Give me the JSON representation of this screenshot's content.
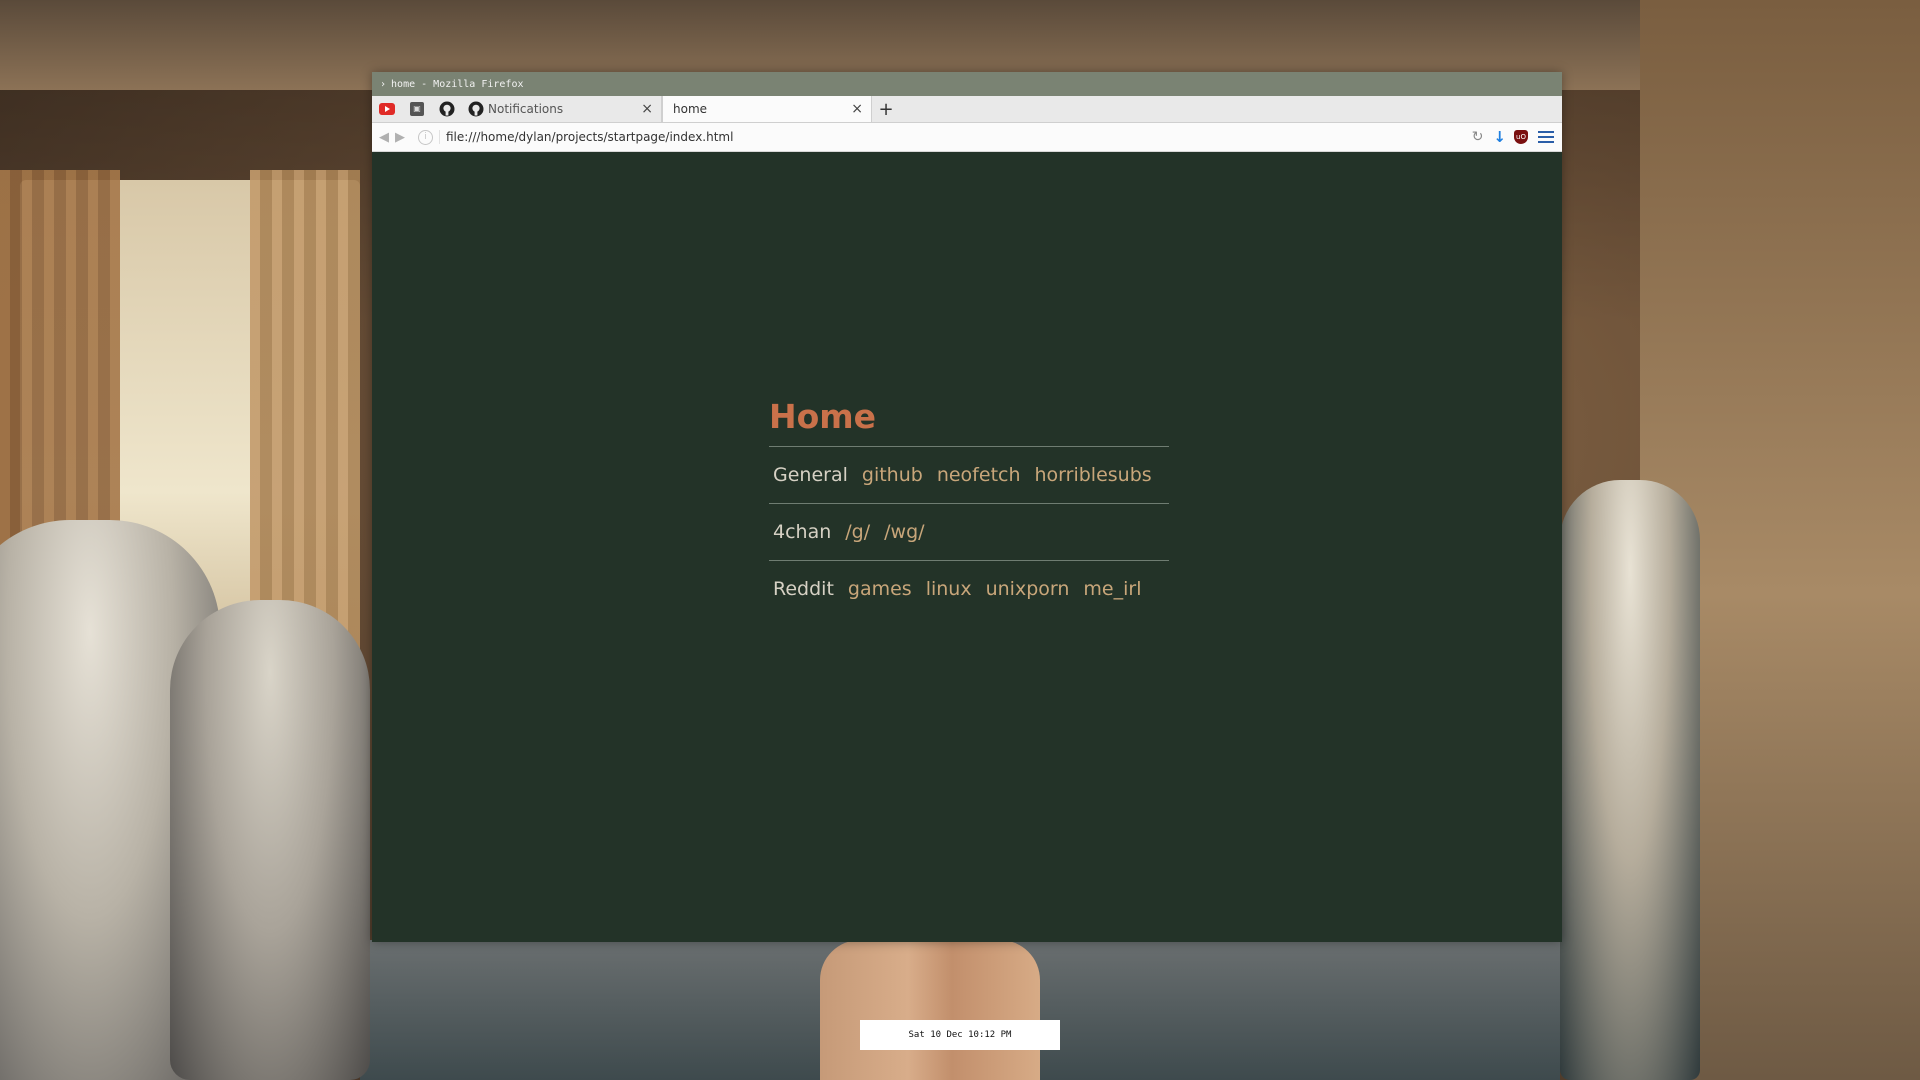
{
  "window": {
    "title": "home - Mozilla Firefox"
  },
  "tabs": {
    "pinned": [
      {
        "icon": "youtube-icon"
      },
      {
        "icon": "app-icon"
      },
      {
        "icon": "github-icon"
      }
    ],
    "items": [
      {
        "label": "Notifications",
        "icon": "github-icon",
        "active": false
      },
      {
        "label": "home",
        "active": true
      }
    ]
  },
  "navbar": {
    "url": "file:///home/dylan/projects/startpage/index.html"
  },
  "startpage": {
    "title": "Home",
    "rows": [
      {
        "category": "General",
        "links": [
          "github",
          "neofetch",
          "horriblesubs"
        ]
      },
      {
        "category": "4chan",
        "links": [
          "/g/",
          "/wg/"
        ]
      },
      {
        "category": "Reddit",
        "links": [
          "games",
          "linux",
          "unixporn",
          "me_irl"
        ]
      }
    ]
  },
  "clock": {
    "text": "Sat 10 Dec 10:12 PM"
  },
  "colors": {
    "page_bg": "#233328",
    "title": "#c9714a",
    "category": "#d6d1c4",
    "link": "#c8a67a",
    "divider": "#6f7d72"
  }
}
